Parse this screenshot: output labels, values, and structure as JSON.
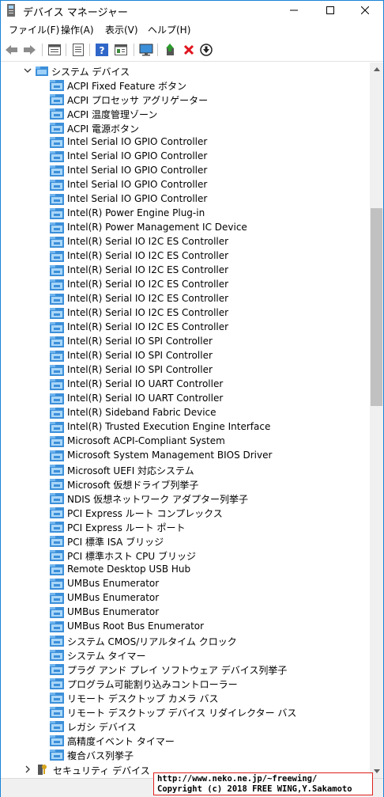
{
  "window": {
    "title": "デバイス マネージャー",
    "buttons": {
      "minimize": "minimize",
      "maximize": "maximize",
      "close": "close"
    }
  },
  "menu": [
    "ファイル(F)",
    "操作(A)",
    "表示(V)",
    "ヘルプ(H)"
  ],
  "toolbar": [
    "back-icon",
    "forward-icon",
    "up-icon",
    "properties-icon",
    "help-icon",
    "view-icon",
    "monitor-icon",
    "update-driver-icon",
    "uninstall-icon",
    "download-icon"
  ],
  "tree": {
    "category": "システム デバイス",
    "devices": [
      "ACPI Fixed Feature ボタン",
      "ACPI プロセッサ アグリゲーター",
      "ACPI 温度管理ゾーン",
      "ACPI 電源ボタン",
      "Intel Serial IO GPIO Controller",
      "Intel Serial IO GPIO Controller",
      "Intel Serial IO GPIO Controller",
      "Intel Serial IO GPIO Controller",
      "Intel Serial IO GPIO Controller",
      "Intel(R) Power Engine Plug-in",
      "Intel(R) Power Management IC Device",
      "Intel(R) Serial IO I2C ES Controller",
      "Intel(R) Serial IO I2C ES Controller",
      "Intel(R) Serial IO I2C ES Controller",
      "Intel(R) Serial IO I2C ES Controller",
      "Intel(R) Serial IO I2C ES Controller",
      "Intel(R) Serial IO I2C ES Controller",
      "Intel(R) Serial IO I2C ES Controller",
      "Intel(R) Serial IO SPI Controller",
      "Intel(R) Serial IO SPI Controller",
      "Intel(R) Serial IO SPI Controller",
      "Intel(R) Serial IO UART Controller",
      "Intel(R) Serial IO UART Controller",
      "Intel(R) Sideband Fabric Device",
      "Intel(R) Trusted Execution Engine Interface",
      "Microsoft ACPI-Compliant System",
      "Microsoft System Management BIOS Driver",
      "Microsoft UEFI 対応システム",
      "Microsoft 仮想ドライブ列挙子",
      "NDIS 仮想ネットワーク アダプター列挙子",
      "PCI Express ルート コンプレックス",
      "PCI Express ルート ポート",
      "PCI 標準 ISA ブリッジ",
      "PCI 標準ホスト CPU ブリッジ",
      "Remote Desktop USB Hub",
      "UMBus Enumerator",
      "UMBus Enumerator",
      "UMBus Enumerator",
      "UMBus Root Bus Enumerator",
      "システム CMOS/リアルタイム クロック",
      "システム タイマー",
      "プラグ アンド プレイ ソフトウェア デバイス列挙子",
      "プログラム可能割り込みコントローラー",
      "リモート デスクトップ カメラ バス",
      "リモート デスクトップ デバイス リダイレクター バス",
      "レガシ デバイス",
      "高精度イベント タイマー",
      "複合バス列挙子"
    ],
    "next_category": "セキュリティ デバイス"
  },
  "scrollbar": {
    "position": 0.27
  },
  "watermark": {
    "line1": "http://www.neko.ne.jp/~freewing/",
    "line2": "Copyright (c) 2018 FREE WING,Y.Sakamoto"
  }
}
